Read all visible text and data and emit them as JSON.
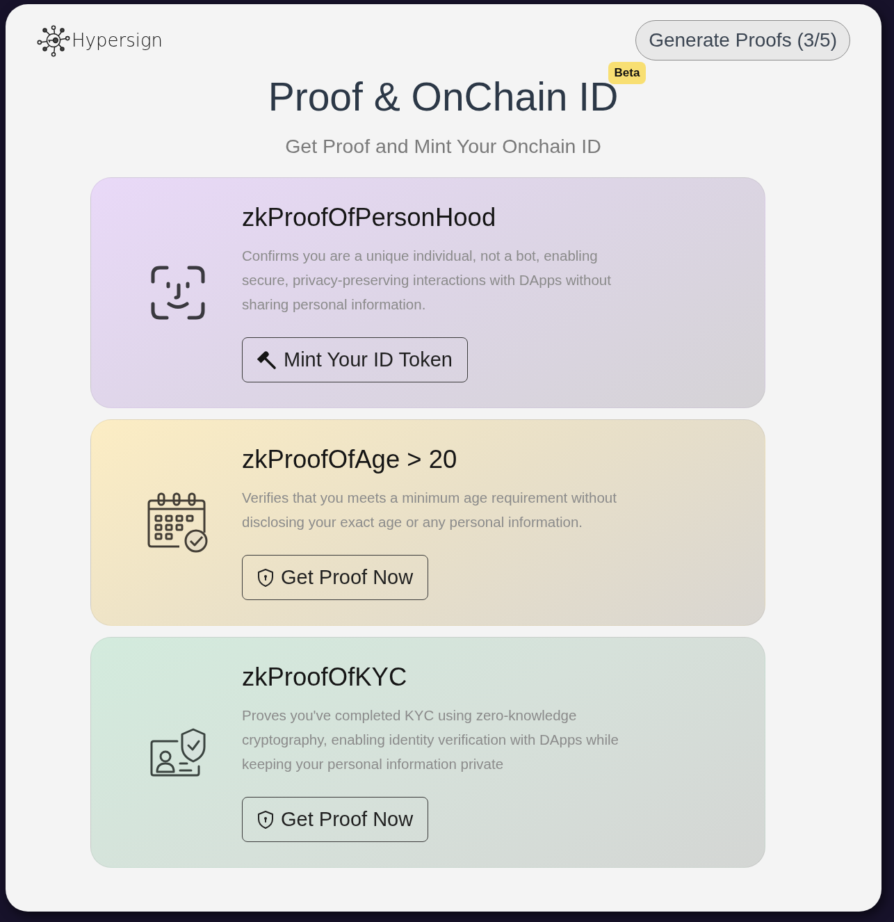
{
  "header": {
    "brand": "Hypersign",
    "action_button": "Generate Proofs (3/5)"
  },
  "hero": {
    "title": "Proof & OnChain ID",
    "badge": "Beta",
    "subtitle": "Get Proof and Mint Your Onchain ID"
  },
  "cards": [
    {
      "kind": "personhood",
      "title": "zkProofOfPersonHood",
      "description": "Confirms you are a unique individual, not a bot, enabling secure, privacy-preserving interactions with DApps without sharing personal information.",
      "button": {
        "kind": "mint",
        "label": "Mint Your ID Token"
      }
    },
    {
      "kind": "age",
      "title": "zkProofOfAge > 20",
      "description": "Verifies that you meets a minimum age requirement without disclosing your exact age or any personal information.",
      "button": {
        "kind": "proof",
        "label": "Get Proof Now"
      }
    },
    {
      "kind": "kyc",
      "title": "zkProofOfKYC",
      "description": "Proves you've completed KYC using zero-knowledge cryptography, enabling identity verification with DApps while keeping your personal information private",
      "button": {
        "kind": "proof",
        "label": "Get Proof Now"
      }
    }
  ]
}
